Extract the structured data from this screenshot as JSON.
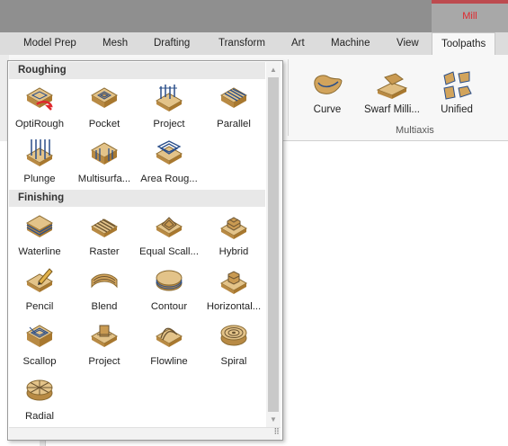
{
  "title_bar": {
    "context_tab_label": "Mill"
  },
  "tabs": [
    {
      "label": "Model Prep",
      "active": false
    },
    {
      "label": "Mesh",
      "active": false
    },
    {
      "label": "Drafting",
      "active": false
    },
    {
      "label": "Transform",
      "active": false
    },
    {
      "label": "Art",
      "active": false
    },
    {
      "label": "Machine",
      "active": false
    },
    {
      "label": "View",
      "active": false
    },
    {
      "label": "Toolpaths",
      "active": true
    }
  ],
  "ribbon": {
    "buttons": [
      {
        "label": "Curve",
        "icon": "curve-toolpath-icon"
      },
      {
        "label": "Swarf Milli...",
        "icon": "swarf-milling-icon"
      },
      {
        "label": "Unified",
        "icon": "unified-toolpath-icon"
      }
    ],
    "group_label": "Multiaxis"
  },
  "dropdown": {
    "sections": [
      {
        "header": "Roughing",
        "items": [
          {
            "label": "OptiRough",
            "icon": "optirough-icon"
          },
          {
            "label": "Pocket",
            "icon": "pocket-icon"
          },
          {
            "label": "Project",
            "icon": "project-icon"
          },
          {
            "label": "Parallel",
            "icon": "parallel-icon"
          },
          {
            "label": "Plunge",
            "icon": "plunge-icon"
          },
          {
            "label": "Multisurfa...",
            "icon": "multisurface-icon"
          },
          {
            "label": "Area Roug...",
            "icon": "area-roughing-icon"
          }
        ]
      },
      {
        "header": "Finishing",
        "items": [
          {
            "label": "Waterline",
            "icon": "waterline-icon"
          },
          {
            "label": "Raster",
            "icon": "raster-icon"
          },
          {
            "label": "Equal Scall...",
            "icon": "equal-scallop-icon"
          },
          {
            "label": "Hybrid",
            "icon": "hybrid-icon"
          },
          {
            "label": "Pencil",
            "icon": "pencil-icon"
          },
          {
            "label": "Blend",
            "icon": "blend-icon"
          },
          {
            "label": "Contour",
            "icon": "contour-icon"
          },
          {
            "label": "Horizontal...",
            "icon": "horizontal-icon"
          },
          {
            "label": "Scallop",
            "icon": "scallop-icon"
          },
          {
            "label": "Project",
            "icon": "project-finish-icon"
          },
          {
            "label": "Flowline",
            "icon": "flowline-icon"
          },
          {
            "label": "Spiral",
            "icon": "spiral-icon"
          },
          {
            "label": "Radial",
            "icon": "radial-icon"
          }
        ]
      }
    ]
  },
  "colors": {
    "accent_red": "#e0282e",
    "part_tan": "#d2a45c",
    "toolpath_blue": "#2b4f8a"
  }
}
